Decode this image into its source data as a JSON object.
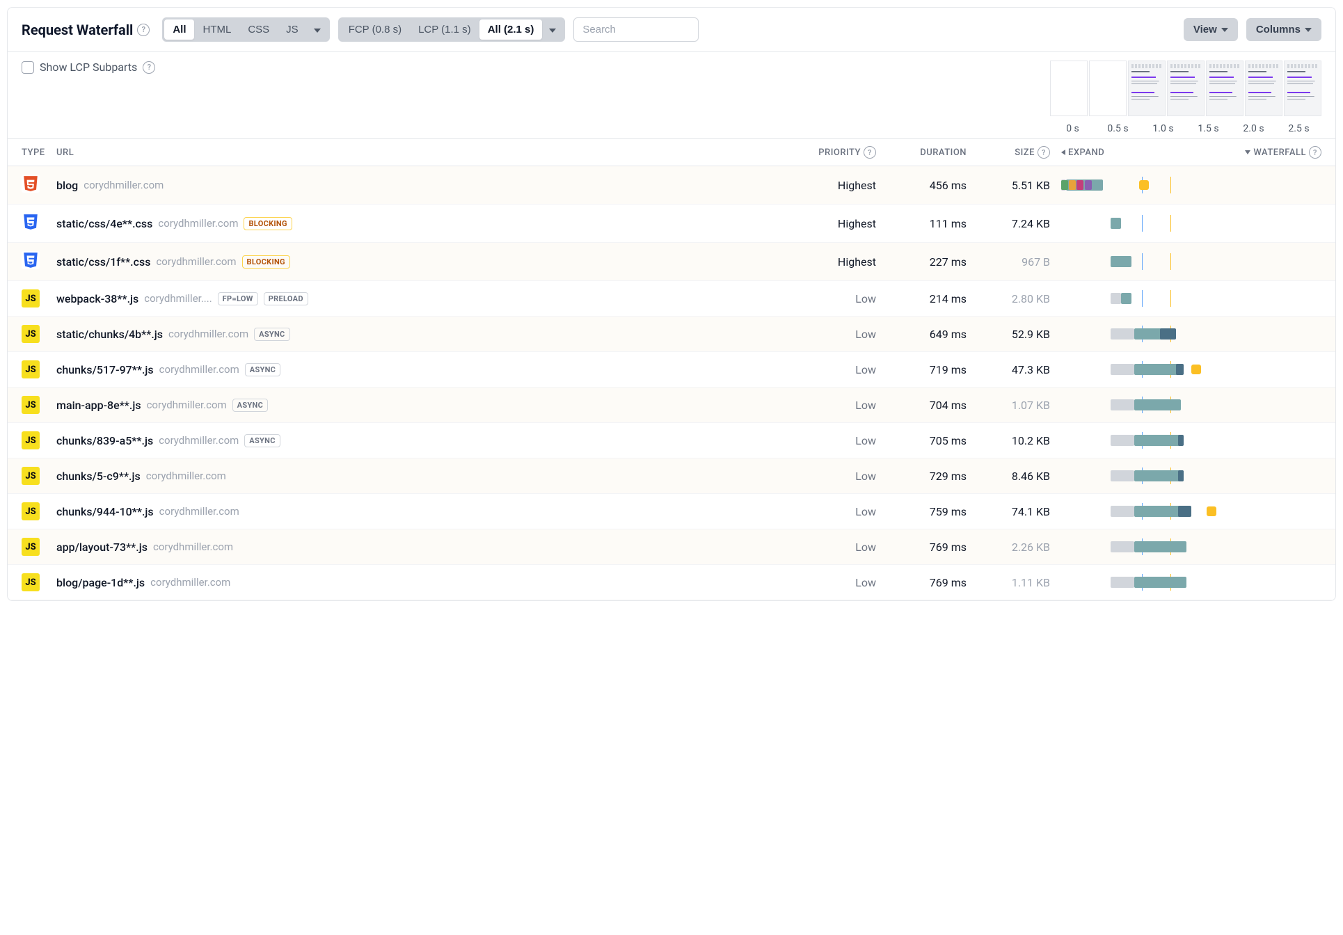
{
  "header": {
    "title": "Request Waterfall",
    "type_filter": {
      "options": [
        "All",
        "HTML",
        "CSS",
        "JS"
      ],
      "active": "All"
    },
    "time_filter": {
      "fcp": "FCP (0.8 s)",
      "lcp": "LCP (1.1 s)",
      "all": "All (2.1 s)",
      "active": "All (2.1 s)"
    },
    "search_placeholder": "Search",
    "view_button": "View",
    "columns_button": "Columns"
  },
  "subbar": {
    "lcp_subparts_label": "Show LCP Subparts",
    "timeline": [
      "0 s",
      "0.5 s",
      "1.0 s",
      "1.5 s",
      "2.0 s",
      "2.5 s"
    ]
  },
  "columns": {
    "type": "TYPE",
    "url": "URL",
    "priority": "PRIORITY",
    "duration": "DURATION",
    "size": "SIZE",
    "expand": "EXPAND",
    "waterfall": "WATERFALL"
  },
  "markers": {
    "fcp_pct": 31,
    "lcp_pct": 42
  },
  "chart_data": {
    "type": "table",
    "title": "Request Waterfall",
    "x_unit": "seconds",
    "x_range": [
      0,
      2.6
    ],
    "markers": {
      "fcp_s": 0.8,
      "lcp_s": 1.1
    },
    "rows": [
      {
        "url": "blog",
        "duration_ms": 456,
        "size": "5.51 KB",
        "priority": "Highest",
        "start_s": 0.0,
        "end_s": 0.456
      },
      {
        "url": "static/css/4e**.css",
        "duration_ms": 111,
        "size": "7.24 KB",
        "priority": "Highest",
        "start_s": 0.5,
        "end_s": 0.611
      },
      {
        "url": "static/css/1f**.css",
        "duration_ms": 227,
        "size": "967 B",
        "priority": "Highest",
        "start_s": 0.5,
        "end_s": 0.727
      },
      {
        "url": "webpack-38**.js",
        "duration_ms": 214,
        "size": "2.80 KB",
        "priority": "Low",
        "start_s": 0.5,
        "end_s": 0.714
      },
      {
        "url": "static/chunks/4b**.js",
        "duration_ms": 649,
        "size": "52.9 KB",
        "priority": "Low",
        "start_s": 0.5,
        "end_s": 1.149
      },
      {
        "url": "chunks/517-97**.js",
        "duration_ms": 719,
        "size": "47.3 KB",
        "priority": "Low",
        "start_s": 0.5,
        "end_s": 1.219
      },
      {
        "url": "main-app-8e**.js",
        "duration_ms": 704,
        "size": "1.07 KB",
        "priority": "Low",
        "start_s": 0.5,
        "end_s": 1.204
      },
      {
        "url": "chunks/839-a5**.js",
        "duration_ms": 705,
        "size": "10.2 KB",
        "priority": "Low",
        "start_s": 0.5,
        "end_s": 1.205
      },
      {
        "url": "chunks/5-c9**.js",
        "duration_ms": 729,
        "size": "8.46 KB",
        "priority": "Low",
        "start_s": 0.5,
        "end_s": 1.229
      },
      {
        "url": "chunks/944-10**.js",
        "duration_ms": 759,
        "size": "74.1 KB",
        "priority": "Low",
        "start_s": 0.5,
        "end_s": 1.259
      },
      {
        "url": "app/layout-73**.js",
        "duration_ms": 769,
        "size": "2.26 KB",
        "priority": "Low",
        "start_s": 0.5,
        "end_s": 1.269
      },
      {
        "url": "blog/page-1d**.js",
        "duration_ms": 769,
        "size": "1.11 KB",
        "priority": "Low",
        "start_s": 0.5,
        "end_s": 1.269
      }
    ]
  },
  "rows": [
    {
      "type": "html",
      "path": "blog",
      "host": "corydhmiller.com",
      "tags": [],
      "priority": "Highest",
      "priority_low": false,
      "duration": "456 ms",
      "size": "5.51 KB",
      "size_faded": false,
      "wf": {
        "wait_l": 0,
        "wait_w": 2,
        "main_l": 2,
        "main_w": 14,
        "chips": [
          {
            "l": 0,
            "c": "#5aa36a"
          },
          {
            "l": 3,
            "c": "#e8a23b"
          },
          {
            "l": 6,
            "c": "#c43d7a"
          },
          {
            "l": 9,
            "c": "#8a5fb0"
          }
        ],
        "yellow_l": 30
      }
    },
    {
      "type": "css",
      "path": "static/css/4e**.css",
      "host": "corydhmiller.com",
      "tags": [
        "BLOCKING"
      ],
      "priority": "Highest",
      "priority_low": false,
      "duration": "111 ms",
      "size": "7.24 KB",
      "size_faded": false,
      "wf": {
        "wait_l": 19,
        "wait_w": 0,
        "main_l": 19,
        "main_w": 4
      }
    },
    {
      "type": "css",
      "path": "static/css/1f**.css",
      "host": "corydhmiller.com",
      "tags": [
        "BLOCKING"
      ],
      "priority": "Highest",
      "priority_low": false,
      "duration": "227 ms",
      "size": "967 B",
      "size_faded": true,
      "wf": {
        "wait_l": 19,
        "wait_w": 0,
        "main_l": 19,
        "main_w": 8
      }
    },
    {
      "type": "js",
      "path": "webpack-38**.js",
      "host": "corydhmiller....",
      "tags": [
        "FP=LOW",
        "PRELOAD"
      ],
      "priority": "Low",
      "priority_low": true,
      "duration": "214 ms",
      "size": "2.80 KB",
      "size_faded": true,
      "wf": {
        "wait_l": 19,
        "wait_w": 4,
        "main_l": 23,
        "main_w": 4
      }
    },
    {
      "type": "js",
      "path": "static/chunks/4b**.js",
      "host": "corydhmiller.com",
      "tags": [
        "ASYNC"
      ],
      "priority": "Low",
      "priority_low": true,
      "duration": "649 ms",
      "size": "52.9 KB",
      "size_faded": false,
      "wf": {
        "wait_l": 19,
        "wait_w": 9,
        "main_l": 28,
        "main_w": 14,
        "dark_l": 38,
        "dark_w": 6
      }
    },
    {
      "type": "js",
      "path": "chunks/517-97**.js",
      "host": "corydhmiller.com",
      "tags": [
        "ASYNC"
      ],
      "priority": "Low",
      "priority_low": true,
      "duration": "719 ms",
      "size": "47.3 KB",
      "size_faded": false,
      "wf": {
        "wait_l": 19,
        "wait_w": 9,
        "main_l": 28,
        "main_w": 18,
        "dark_l": 44,
        "dark_w": 3,
        "yellow_l": 50
      }
    },
    {
      "type": "js",
      "path": "main-app-8e**.js",
      "host": "corydhmiller.com",
      "tags": [
        "ASYNC"
      ],
      "priority": "Low",
      "priority_low": true,
      "duration": "704 ms",
      "size": "1.07 KB",
      "size_faded": true,
      "wf": {
        "wait_l": 19,
        "wait_w": 9,
        "main_l": 28,
        "main_w": 18
      }
    },
    {
      "type": "js",
      "path": "chunks/839-a5**.js",
      "host": "corydhmiller.com",
      "tags": [
        "ASYNC"
      ],
      "priority": "Low",
      "priority_low": true,
      "duration": "705 ms",
      "size": "10.2 KB",
      "size_faded": false,
      "wf": {
        "wait_l": 19,
        "wait_w": 9,
        "main_l": 28,
        "main_w": 18,
        "dark_l": 45,
        "dark_w": 2
      }
    },
    {
      "type": "js",
      "path": "chunks/5-c9**.js",
      "host": "corydhmiller.com",
      "tags": [],
      "priority": "Low",
      "priority_low": true,
      "duration": "729 ms",
      "size": "8.46 KB",
      "size_faded": false,
      "wf": {
        "wait_l": 19,
        "wait_w": 9,
        "main_l": 28,
        "main_w": 19,
        "dark_l": 45,
        "dark_w": 2
      }
    },
    {
      "type": "js",
      "path": "chunks/944-10**.js",
      "host": "corydhmiller.com",
      "tags": [],
      "priority": "Low",
      "priority_low": true,
      "duration": "759 ms",
      "size": "74.1 KB",
      "size_faded": false,
      "wf": {
        "wait_l": 19,
        "wait_w": 9,
        "main_l": 28,
        "main_w": 21,
        "dark_l": 45,
        "dark_w": 5,
        "yellow_l": 56
      }
    },
    {
      "type": "js",
      "path": "app/layout-73**.js",
      "host": "corydhmiller.com",
      "tags": [],
      "priority": "Low",
      "priority_low": true,
      "duration": "769 ms",
      "size": "2.26 KB",
      "size_faded": true,
      "wf": {
        "wait_l": 19,
        "wait_w": 9,
        "main_l": 28,
        "main_w": 20
      }
    },
    {
      "type": "js",
      "path": "blog/page-1d**.js",
      "host": "corydhmiller.com",
      "tags": [],
      "priority": "Low",
      "priority_low": true,
      "duration": "769 ms",
      "size": "1.11 KB",
      "size_faded": true,
      "wf": {
        "wait_l": 19,
        "wait_w": 9,
        "main_l": 28,
        "main_w": 20
      }
    }
  ]
}
